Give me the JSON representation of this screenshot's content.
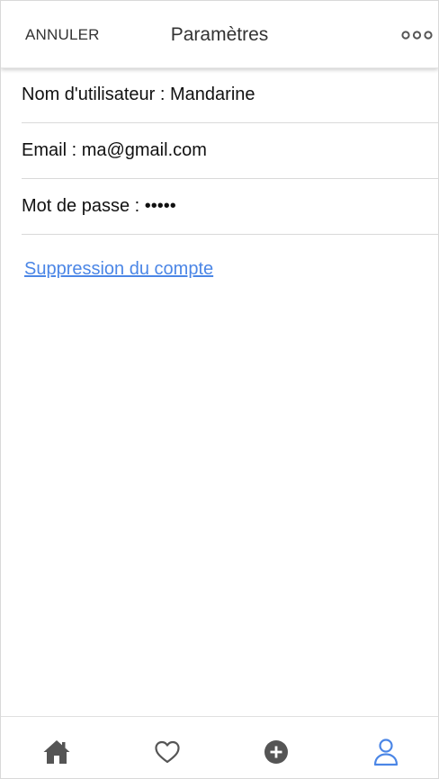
{
  "header": {
    "cancel_label": "ANNULER",
    "title": "Paramètres",
    "more_icon": "more-horizontal-icon"
  },
  "settings": {
    "rows": [
      {
        "label": "Nom d'utilisateur : ",
        "value": "Mandarine"
      },
      {
        "label": "Email : ",
        "value": "ma@gmail.com"
      },
      {
        "label": "Mot de passe : ",
        "value": "•••••"
      }
    ],
    "delete_account_label": "Suppression du compte"
  },
  "bottom_nav": {
    "items": [
      {
        "icon": "home-icon",
        "active": false
      },
      {
        "icon": "heart-icon",
        "active": false
      },
      {
        "icon": "add-circle-icon",
        "active": false
      },
      {
        "icon": "user-icon",
        "active": true
      }
    ]
  },
  "colors": {
    "accent": "#4b86e6",
    "icon_inactive": "#555555",
    "divider": "#d9d9d9"
  }
}
